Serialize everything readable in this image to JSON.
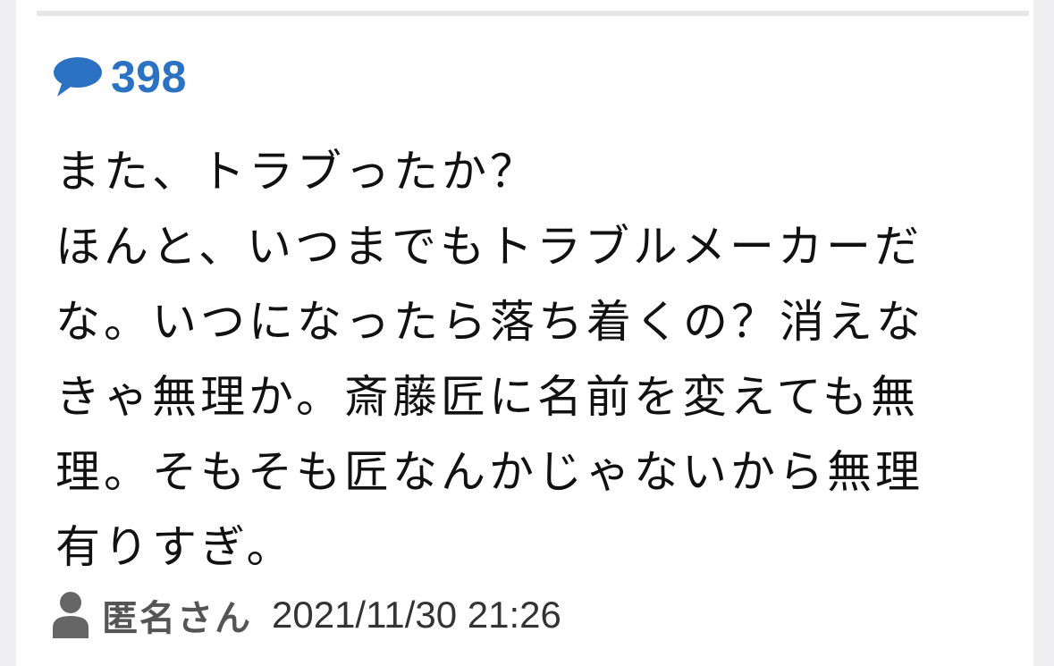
{
  "comment": {
    "count": "398",
    "body_lines": [
      "また、トラブったか？",
      "ほんと、いつまでもトラブルメーカーだ",
      "な。いつになったら落ち着くの？消えな",
      "きゃ無理か。斎藤匠に名前を変えても無",
      "理。そもそも匠なんかじゃないから無理",
      "有りすぎ。"
    ],
    "author": "匿名さん",
    "timestamp": "2021/11/30 21:26"
  },
  "icons": {
    "count_icon": "speech-bubble-icon",
    "author_icon": "person-icon"
  },
  "colors": {
    "accent": "#2c72c3",
    "text": "#111111",
    "meta": "#555555",
    "divider": "#e6e6e8",
    "background": "#efeff2"
  }
}
